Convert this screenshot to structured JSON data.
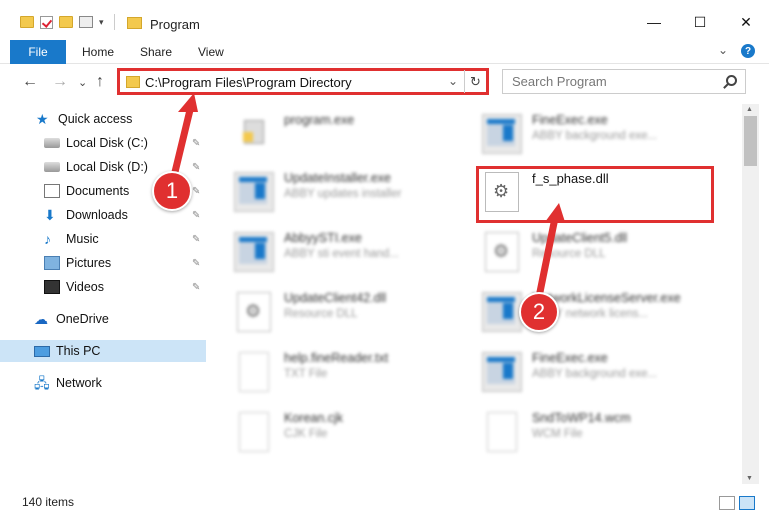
{
  "window": {
    "title": "Program",
    "controls": {
      "minimize": "—",
      "maximize": "☐",
      "close": "✕"
    }
  },
  "ribbon": {
    "file_label": "File",
    "tabs": [
      "Home",
      "Share",
      "View"
    ],
    "expand": "⌄",
    "help": "?"
  },
  "nav": {
    "back": "←",
    "forward": "→",
    "recent": "⌄",
    "up": "↑"
  },
  "address": {
    "path": "C:\\Program Files\\Program Directory",
    "dropdown": "⌄",
    "refresh": "↻"
  },
  "search": {
    "placeholder": "Search Program"
  },
  "sidebar": {
    "items": [
      {
        "label": "Quick access",
        "icon": "star-icon"
      },
      {
        "label": "Local Disk (C:)",
        "icon": "disk-icon",
        "pinned": "📌"
      },
      {
        "label": "Local Disk (D:)",
        "icon": "disk-icon",
        "pinned": "📌"
      },
      {
        "label": "Documents",
        "icon": "documents-icon",
        "pinned": "📌"
      },
      {
        "label": "Downloads",
        "icon": "download-icon",
        "pinned": "📌"
      },
      {
        "label": "Music",
        "icon": "music-icon",
        "pinned": "📌"
      },
      {
        "label": "Pictures",
        "icon": "pictures-icon",
        "pinned": "📌"
      },
      {
        "label": "Videos",
        "icon": "videos-icon",
        "pinned": "📌"
      },
      {
        "label": "OneDrive",
        "icon": "cloud-icon"
      },
      {
        "label": "This PC",
        "icon": "computer-icon"
      },
      {
        "label": "Network",
        "icon": "network-icon"
      }
    ]
  },
  "files": [
    {
      "name": "program.exe",
      "desc": "",
      "type": "prog"
    },
    {
      "name": "FineExec.exe",
      "desc": "ABBY background exe...",
      "type": "exe"
    },
    {
      "name": "UpdateInstaller.exe",
      "desc": "ABBY updates installer",
      "type": "exe"
    },
    {
      "name": "f_s_phase.dll",
      "desc": "",
      "type": "dll"
    },
    {
      "name": "AbbyySTI.exe",
      "desc": "ABBY sti event hand...",
      "type": "exe"
    },
    {
      "name": "UpdateClient5.dll",
      "desc": "Resource DLL",
      "type": "dll"
    },
    {
      "name": "UpdateClient42.dll",
      "desc": "Resource DLL",
      "type": "dll"
    },
    {
      "name": "NetworkLicenseServer.exe",
      "desc": "ABBY network licens...",
      "type": "exe"
    },
    {
      "name": "help.fineReader.txt",
      "desc": "TXT File",
      "type": "txt"
    },
    {
      "name": "FineExec.exe",
      "desc": "ABBY background exe...",
      "type": "exe"
    },
    {
      "name": "Korean.cjk",
      "desc": "CJK File",
      "type": "txt"
    },
    {
      "name": "SndToWP14.wcm",
      "desc": "WCM File",
      "type": "txt"
    }
  ],
  "annotations": {
    "step1": "1",
    "step2": "2",
    "color": "#e03030"
  },
  "status": {
    "item_count": "140 items"
  }
}
